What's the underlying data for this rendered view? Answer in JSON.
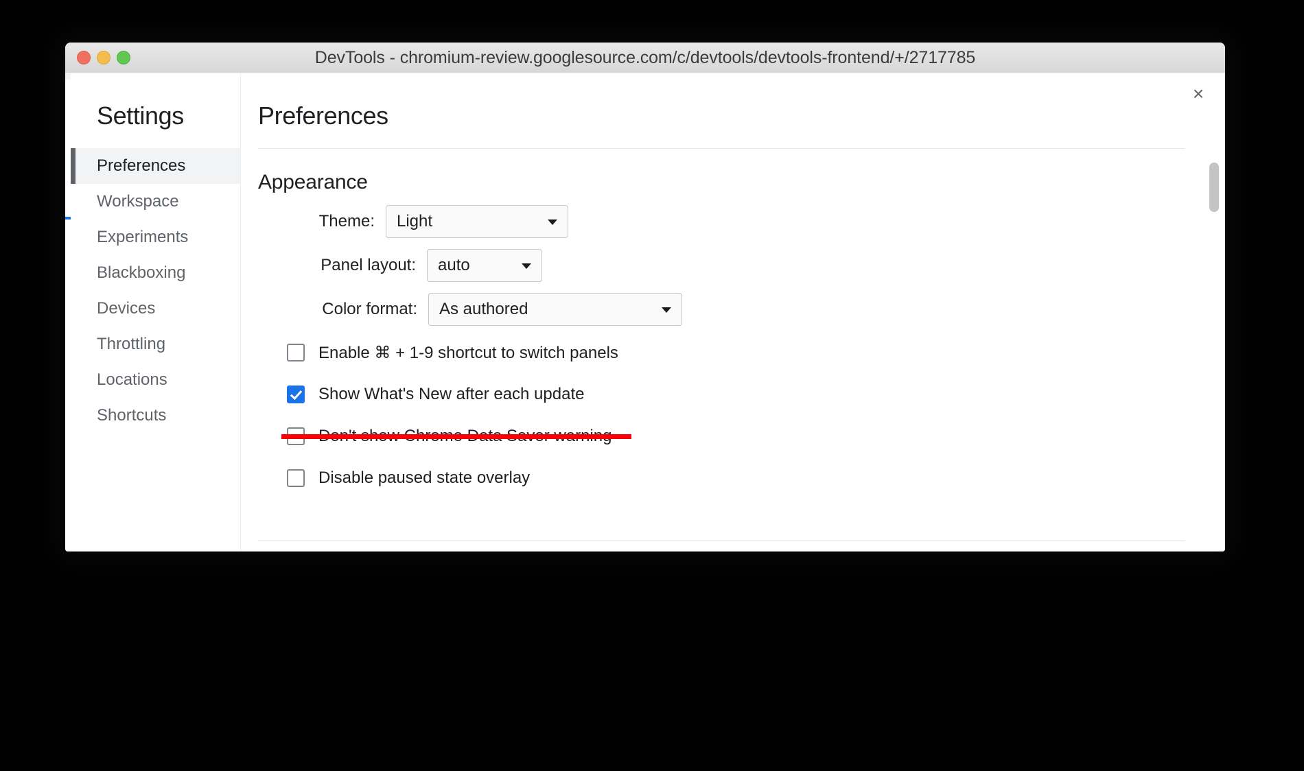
{
  "window": {
    "title": "DevTools - chromium-review.googlesource.com/c/devtools/devtools-frontend/+/2717785",
    "traffic_lights": {
      "close_label": "close-window",
      "minimize_label": "minimize-window",
      "zoom_label": "zoom-window"
    },
    "colors": {
      "close": "#ef6f60",
      "minimize": "#f3bd4e",
      "zoom": "#62c554",
      "accent_blue": "#1a73e8",
      "strike_red": "#fb0007",
      "selected_bg": "#f1f3f4",
      "selected_rail": "#5f6368"
    }
  },
  "dialog": {
    "close_icon": "×",
    "sidebar": {
      "title": "Settings",
      "items": [
        {
          "label": "Preferences",
          "selected": true
        },
        {
          "label": "Workspace",
          "selected": false
        },
        {
          "label": "Experiments",
          "selected": false
        },
        {
          "label": "Blackboxing",
          "selected": false
        },
        {
          "label": "Devices",
          "selected": false
        },
        {
          "label": "Throttling",
          "selected": false
        },
        {
          "label": "Locations",
          "selected": false
        },
        {
          "label": "Shortcuts",
          "selected": false
        }
      ]
    },
    "main": {
      "title": "Preferences",
      "sections": [
        {
          "heading": "Appearance",
          "selects": [
            {
              "label": "Theme:",
              "value": "Light"
            },
            {
              "label": "Panel layout:",
              "value": "auto"
            },
            {
              "label": "Color format:",
              "value": "As authored"
            }
          ],
          "checkboxes": [
            {
              "label": "Enable ⌘ + 1-9 shortcut to switch panels",
              "checked": false,
              "struck": false
            },
            {
              "label": "Show What's New after each update",
              "checked": true,
              "struck": false
            },
            {
              "label": "Don't show Chrome Data Saver warning",
              "checked": false,
              "struck": true
            },
            {
              "label": "Disable paused state overlay",
              "checked": false,
              "struck": false
            }
          ]
        }
      ]
    }
  }
}
